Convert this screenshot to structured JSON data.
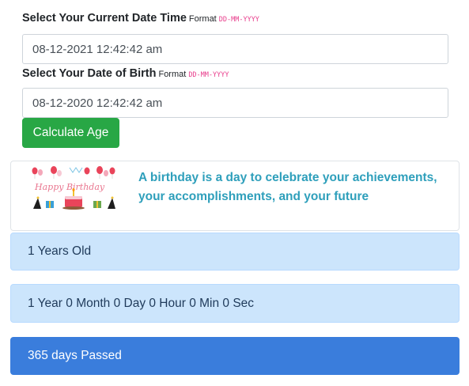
{
  "current_date": {
    "label": "Select Your Current Date Time",
    "format_word": "Format",
    "format_code": "DD-MM-YYYY",
    "value": "08-12-2021 12:42:42 am"
  },
  "birth_date": {
    "label": "Select Your Date of Birth",
    "format_word": "Format",
    "format_code": "DD-MM-YYYY",
    "value": "08-12-2020 12:42:42 am"
  },
  "calculate_button": {
    "label": "Calculate Age"
  },
  "quote": {
    "image_icon": "happy-birthday-illustration",
    "image_text": "Happy Birthday",
    "text": "A birthday is a day to celebrate your achievements, your accomplishments, and your future"
  },
  "results": {
    "years_old": "1 Years Old",
    "breakdown": "1 Year 0 Month 0 Day 0 Hour 0 Min 0 Sec",
    "days_passed": "365 days Passed"
  },
  "colors": {
    "success": "#28a745",
    "quote_text": "#2e9fbb",
    "info_light": "#cce5fc",
    "primary": "#3a7ddc",
    "format_code": "#e83e8c"
  }
}
